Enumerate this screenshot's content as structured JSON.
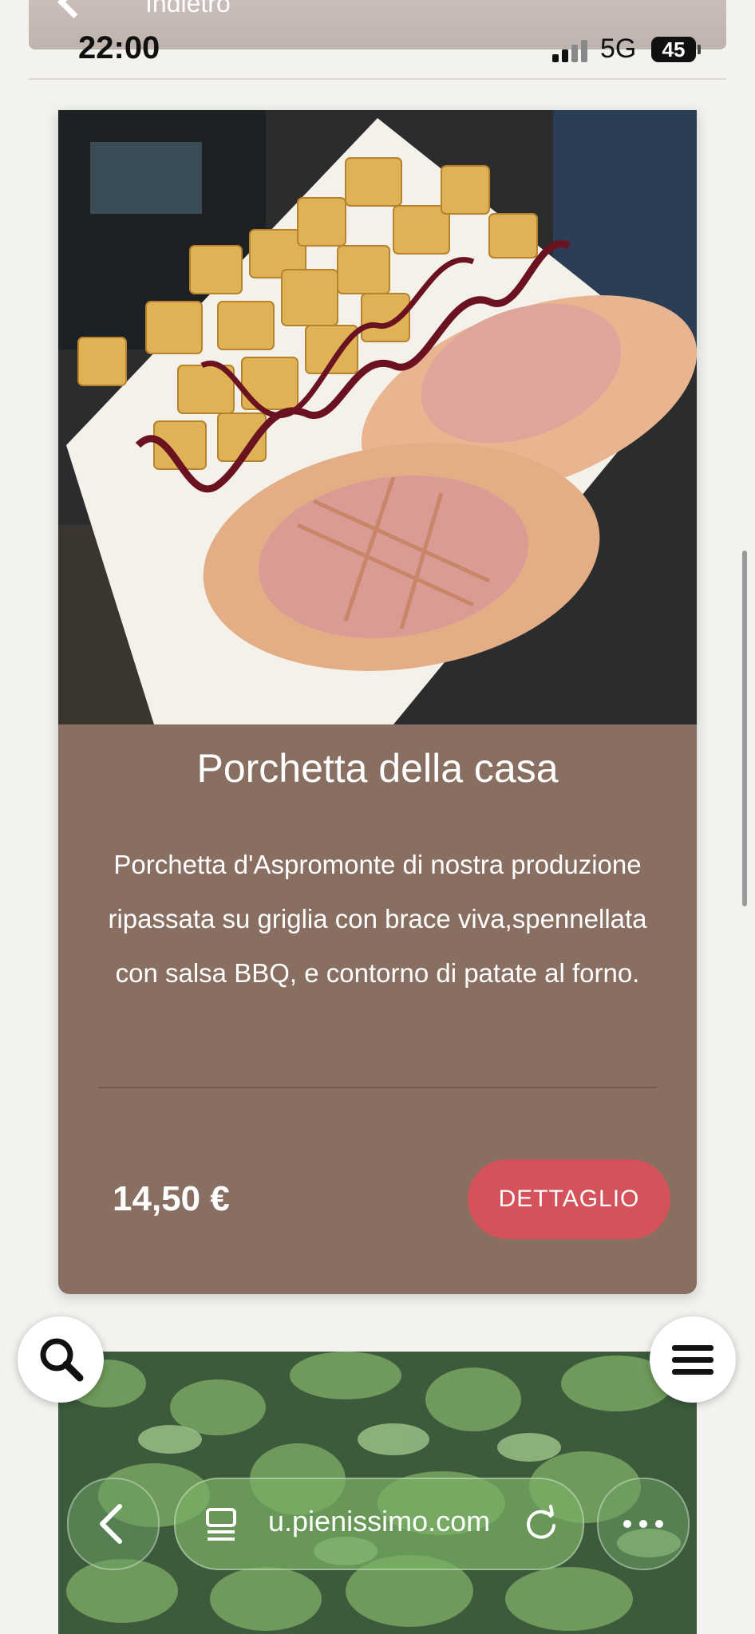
{
  "header": {
    "back_label": "Indietro"
  },
  "status_bar": {
    "time": "22:00",
    "network": "5G",
    "battery": "45"
  },
  "dish": {
    "title": "Porchetta della casa",
    "description": "Porchetta d'Aspromonte di nostra produzione ripassata su griglia con brace viva,spennellata con salsa BBQ, e contorno di patate al forno.",
    "price": "14,50 €",
    "detail_button": "DETTAGLIO"
  },
  "browser": {
    "url": "u.pienissimo.com"
  },
  "colors": {
    "card_background": "#886f62",
    "detail_button": "#d4525a",
    "page_background": "#f3f2ef"
  },
  "icons": [
    "chevron-left-icon",
    "search-icon",
    "hamburger-menu-icon",
    "back-arrow-icon",
    "reader-mode-icon",
    "reload-icon",
    "more-dots-icon",
    "signal-icon",
    "battery-icon"
  ]
}
